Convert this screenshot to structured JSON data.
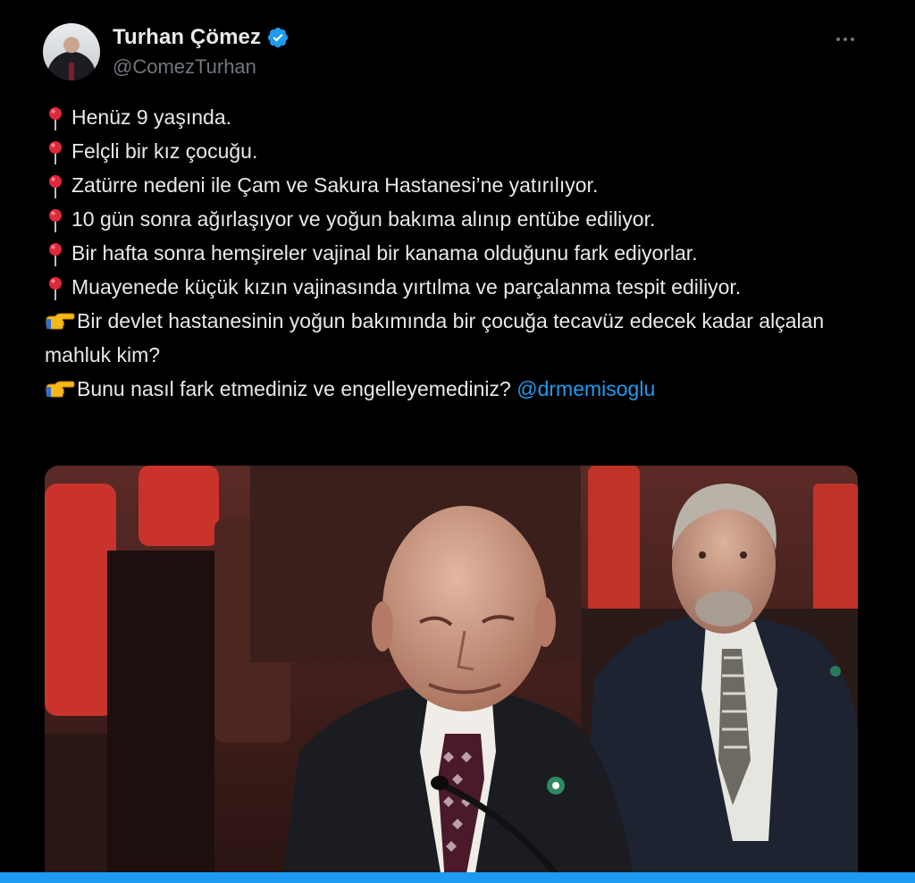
{
  "author": {
    "display_name": "Turhan Çömez",
    "handle": "@ComezTurhan",
    "verified": true,
    "avatar_icon": "profile-photo"
  },
  "more_menu_icon": "more-horizontal-icon",
  "tweet": {
    "lines": [
      {
        "icon": "round-pushpin",
        "text": "Henüz 9 yaşında."
      },
      {
        "icon": "round-pushpin",
        "text": "Felçli bir kız çocuğu."
      },
      {
        "icon": "round-pushpin",
        "text": "Zatürre nedeni ile Çam ve Sakura Hastanesi’ne yatırılıyor."
      },
      {
        "icon": "round-pushpin",
        "text": "10 gün sonra ağırlaşıyor ve yoğun bakıma alınıp entübe ediliyor."
      },
      {
        "icon": "round-pushpin",
        "text": "Bir hafta sonra hemşireler vajinal bir kanama olduğunu fark ediyorlar."
      },
      {
        "icon": "round-pushpin",
        "text": "Muayenede küçük kızın vajinasında yırtılma ve parçalanma tespit ediliyor."
      },
      {
        "icon": "backhand-index-pointing-right",
        "text": "Bir devlet hastanesinin yoğun bakımında bir çocuğa tecavüz edecek kadar alçalan mahluk kim?"
      },
      {
        "icon": "backhand-index-pointing-right",
        "text": "Bunu nasıl fark etmediniz ve engelleyemediniz? ",
        "mention": "@drmemisoglu"
      }
    ]
  },
  "media": {
    "type": "video-still",
    "description_icon": "parliament-speech-photo"
  },
  "colors": {
    "background": "#000000",
    "text": "#e7e9ea",
    "secondary_text": "#71767b",
    "accent": "#1d9bf0",
    "pin_red": "#e0283c"
  }
}
